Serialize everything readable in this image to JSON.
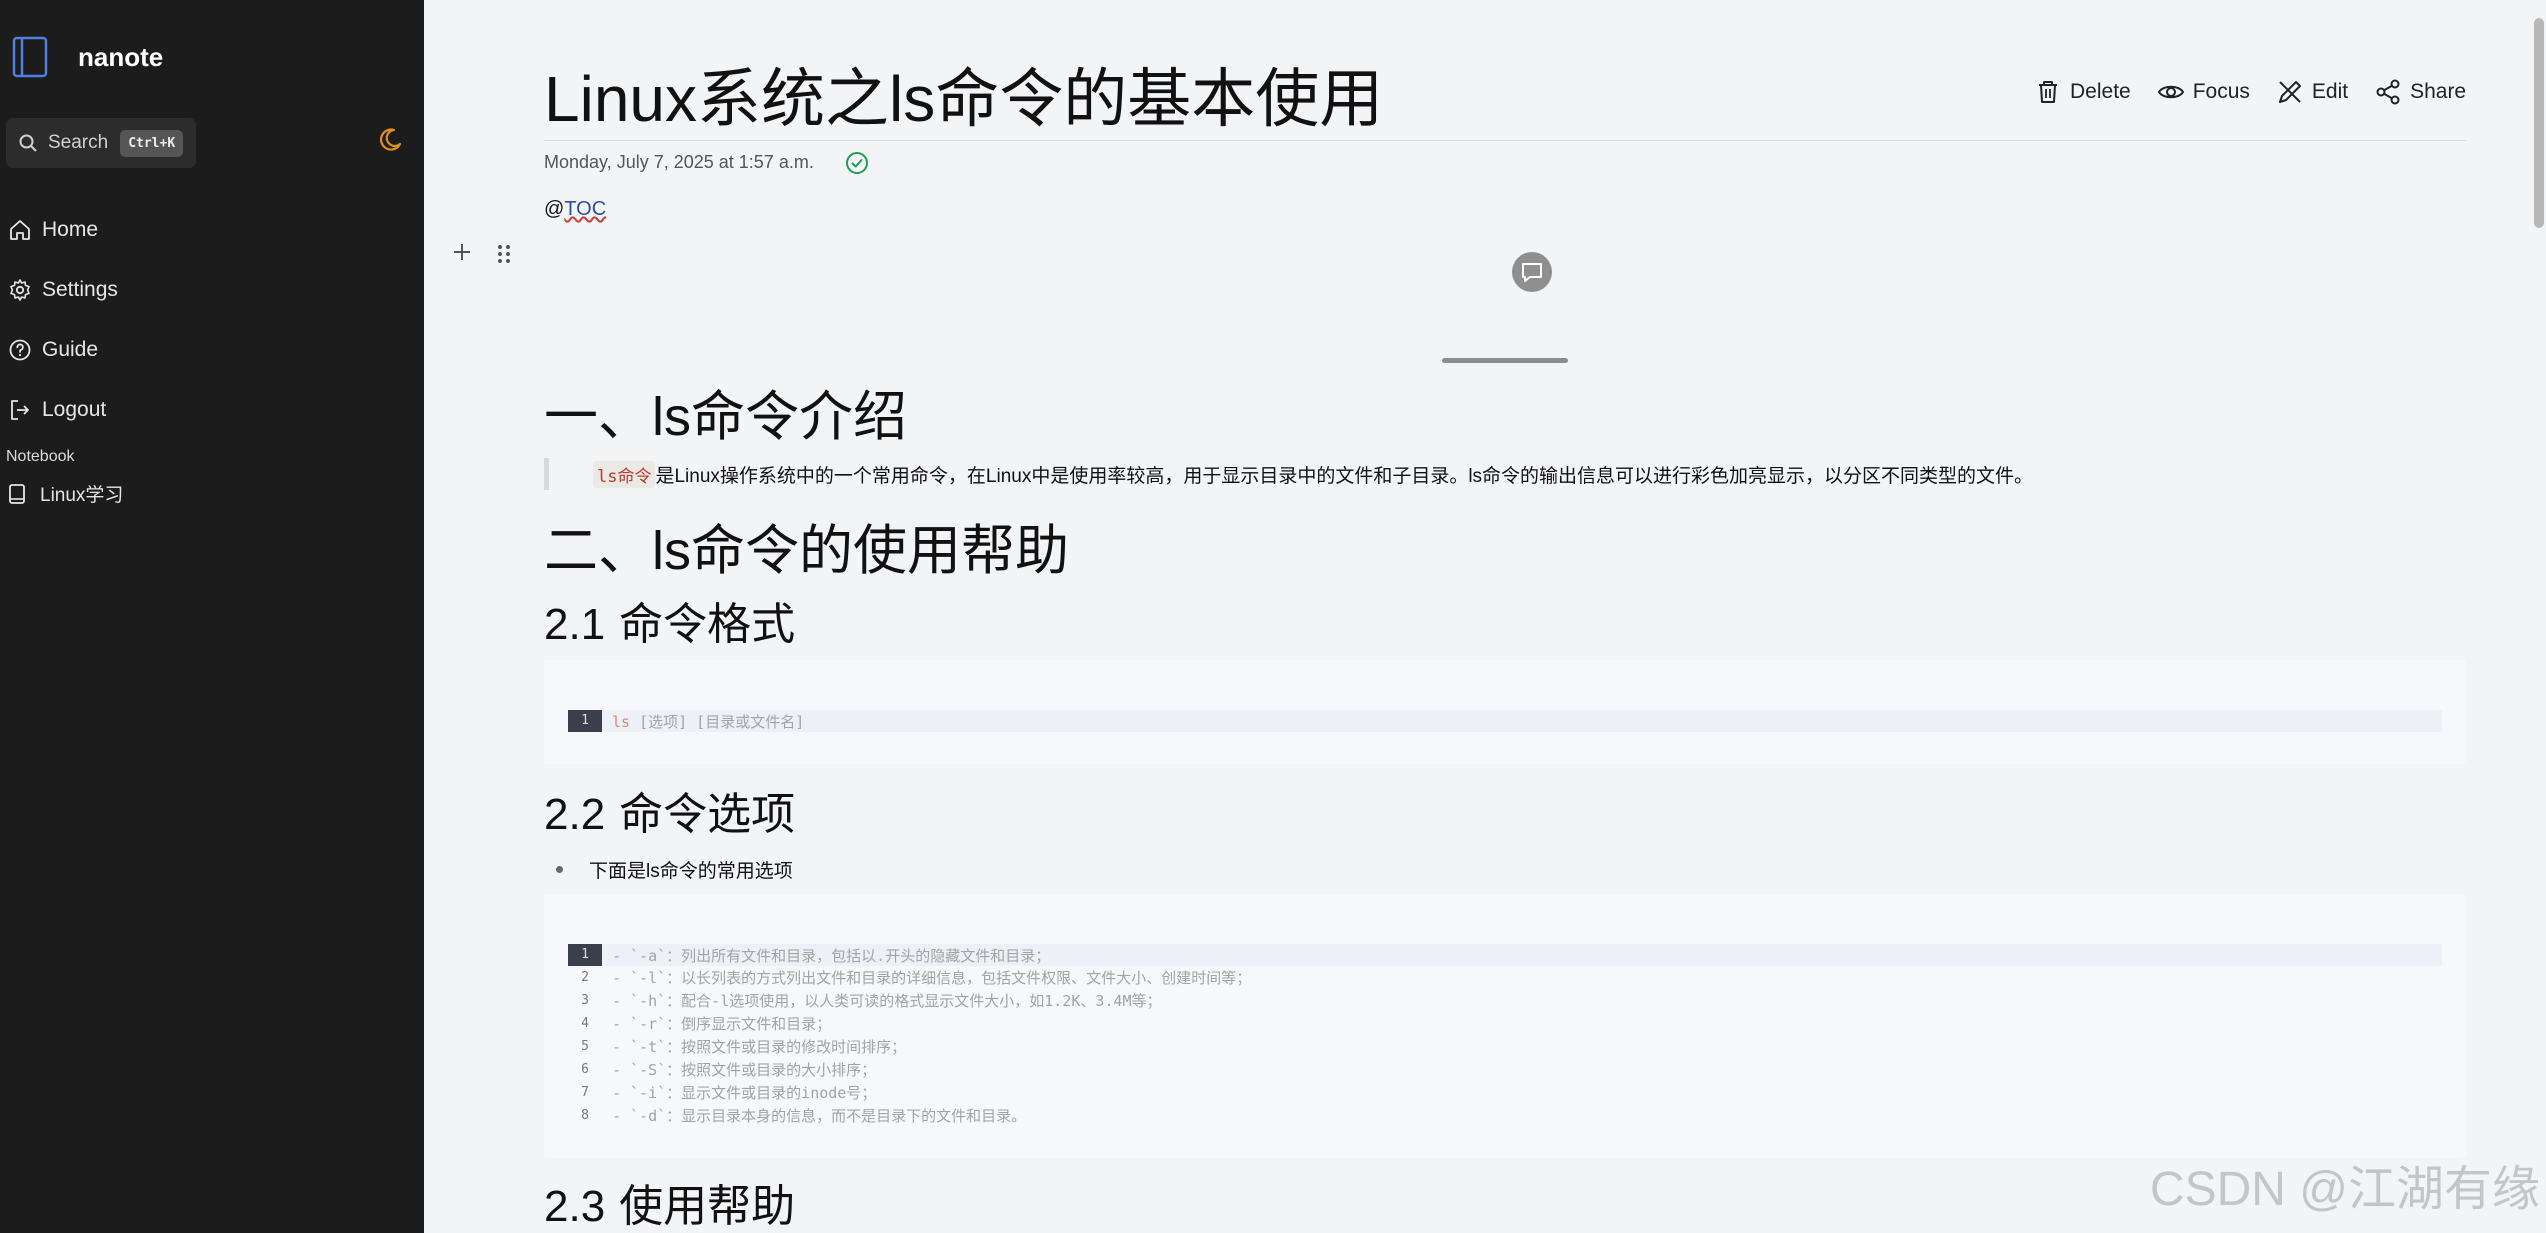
{
  "app": {
    "name": "nanote",
    "colors": {
      "sidebar_bg": "#1c1c1c",
      "accent_orange": "#e0901a",
      "saved_green": "#1f9d55"
    }
  },
  "sidebar": {
    "search": {
      "label": "Search",
      "shortcut": "Ctrl+K"
    },
    "theme_icon": "moon-icon",
    "nav": [
      {
        "label": "Home",
        "icon": "home-icon"
      },
      {
        "label": "Settings",
        "icon": "gear-icon"
      },
      {
        "label": "Guide",
        "icon": "help-icon"
      },
      {
        "label": "Logout",
        "icon": "logout-icon"
      }
    ],
    "notebook_heading": "Notebook",
    "notebooks": [
      {
        "label": "Linux学习",
        "icon": "book-icon"
      }
    ]
  },
  "document": {
    "title": "Linux系统之ls命令的基本使用",
    "date": "Monday, July 7, 2025 at 1:57 a.m.",
    "toc_prefix": "@",
    "toc_word": "TOC",
    "actions": [
      {
        "label": "Delete",
        "icon": "trash-icon"
      },
      {
        "label": "Focus",
        "icon": "eye-icon"
      },
      {
        "label": "Edit",
        "icon": "pencil-icon"
      },
      {
        "label": "Share",
        "icon": "share-icon"
      }
    ],
    "h1_intro_prefix": "一、",
    "h1_intro_latin": "ls",
    "h1_intro_suffix": "命令介绍",
    "intro_code": "ls命令",
    "intro_text": "是Linux操作系统中的一个常用命令，在Linux中是使用率较高，用于显示目录中的文件和子目录。ls命令的输出信息可以进行彩色加亮显示，以分区不同类型的文件。",
    "h1_help_prefix": "二、",
    "h1_help_latin": "ls",
    "h1_help_suffix": "命令的使用帮助",
    "h2_format_num": "2.1",
    "h2_format_text": " 命令格式",
    "format_code": {
      "line": "1",
      "keyword": "ls",
      "rest": " [选项] [目录或文件名]"
    },
    "h2_options_num": "2.2",
    "h2_options_text": " 命令选项",
    "bullet_text": "下面是ls命令的常用选项",
    "options_code": [
      {
        "line": "1",
        "text": "- `-a`：列出所有文件和目录，包括以.开头的隐藏文件和目录；"
      },
      {
        "line": "2",
        "text": "- `-l`：以长列表的方式列出文件和目录的详细信息，包括文件权限、文件大小、创建时间等；"
      },
      {
        "line": "3",
        "text": "- `-h`：配合-l选项使用，以人类可读的格式显示文件大小，如1.2K、3.4M等；"
      },
      {
        "line": "4",
        "text": "- `-r`：倒序显示文件和目录；"
      },
      {
        "line": "5",
        "text": "- `-t`：按照文件或目录的修改时间排序；"
      },
      {
        "line": "6",
        "text": "- `-S`：按照文件或目录的大小排序；"
      },
      {
        "line": "7",
        "text": "- `-i`：显示文件或目录的inode号；"
      },
      {
        "line": "8",
        "text": "- `-d`：显示目录本身的信息，而不是目录下的文件和目录。"
      }
    ],
    "h2_usage_num": "2.3",
    "h2_usage_text": " 使用帮助"
  },
  "watermark": "CSDN @江湖有缘"
}
